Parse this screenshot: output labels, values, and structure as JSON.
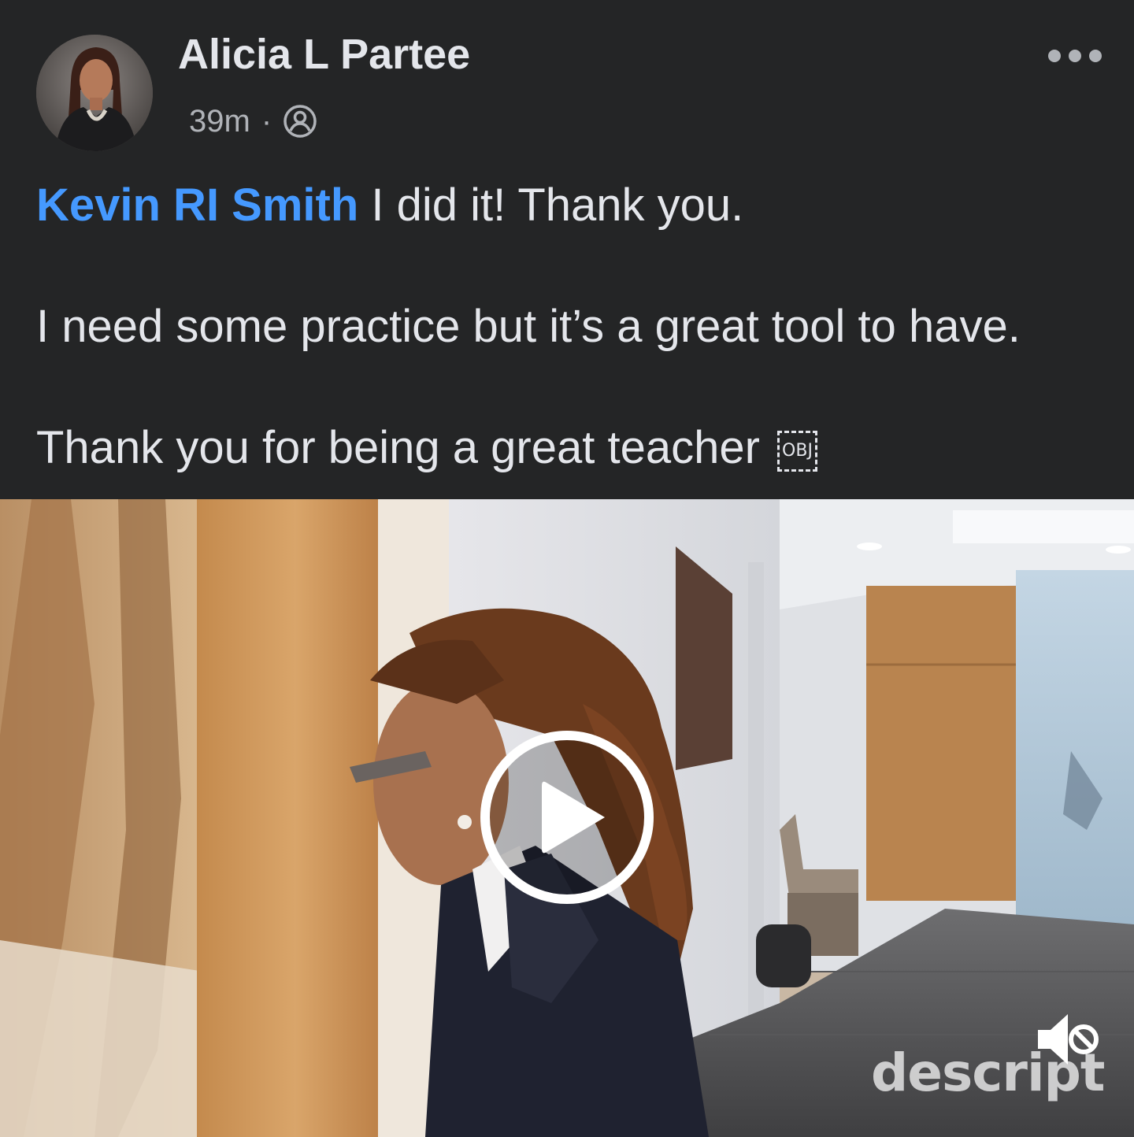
{
  "post": {
    "author": "Alicia L Partee",
    "time": "39m",
    "separator": "·",
    "audience_icon": "friends-icon",
    "more_icon": "more-dots-icon",
    "text": {
      "mention": "Kevin RI Smith",
      "line1_rest": " I did it!   Thank you.",
      "line2": "I need some practice but it’s a great tool to have.",
      "line3": "Thank you for being a great teacher ",
      "object_placeholder": "OBJ"
    }
  },
  "video": {
    "play_icon": "play-icon",
    "mute_icon": "muted-speaker-icon",
    "watermark": "descript"
  },
  "colors": {
    "background": "#242526",
    "text": "#e4e6eb",
    "secondary_text": "#b0b3b8",
    "link": "#4599ff"
  }
}
